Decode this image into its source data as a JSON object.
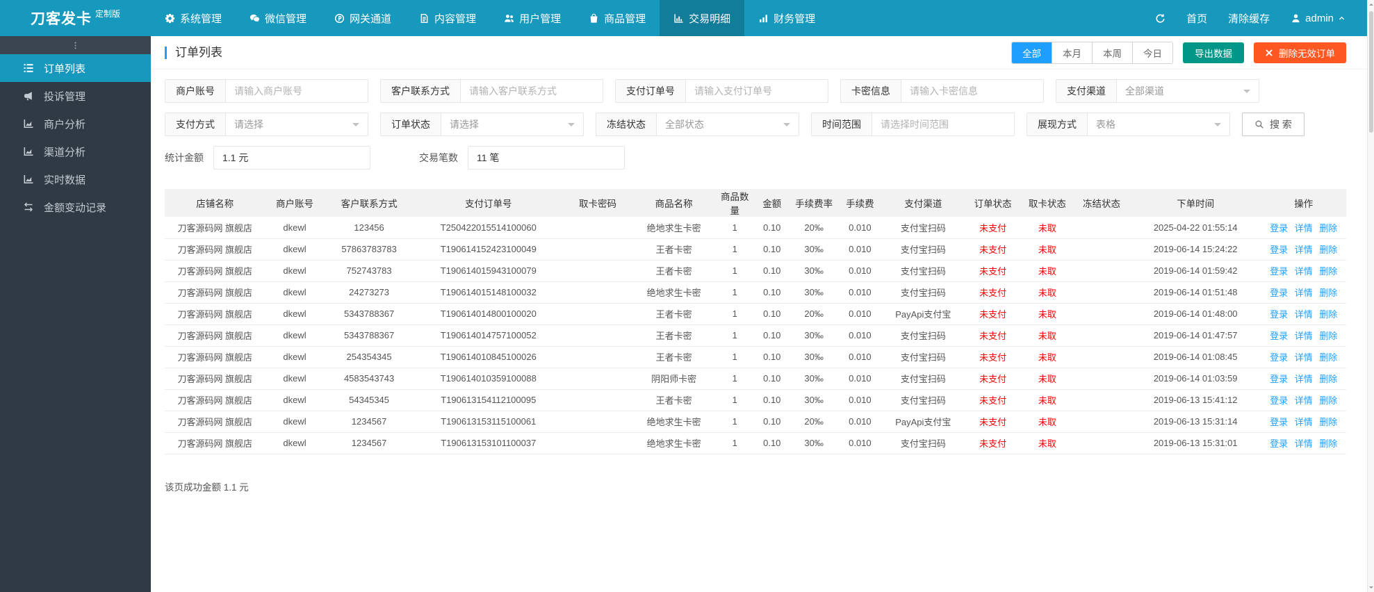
{
  "colors": {
    "navbar": "#1799BD",
    "sidebar": "#2F3A45",
    "accent_blue": "#1E9FFF",
    "teal": "#009688",
    "orange": "#FF5722",
    "status_red": "#FF0000"
  },
  "brand": {
    "name": "刀客发卡",
    "badge": "定制版"
  },
  "navbar": {
    "items": [
      {
        "label": "系统管理",
        "icon": "gear-icon",
        "active": false
      },
      {
        "label": "微信管理",
        "icon": "wechat-icon",
        "active": false
      },
      {
        "label": "网关通道",
        "icon": "gateway-icon",
        "active": false
      },
      {
        "label": "内容管理",
        "icon": "content-icon",
        "active": false
      },
      {
        "label": "用户管理",
        "icon": "users-icon",
        "active": false
      },
      {
        "label": "商品管理",
        "icon": "goods-icon",
        "active": false
      },
      {
        "label": "交易明细",
        "icon": "chart-bar-icon",
        "active": true
      },
      {
        "label": "财务管理",
        "icon": "finance-icon",
        "active": false
      }
    ],
    "refresh_icon": "refresh-icon",
    "home_label": "首页",
    "clear_cache_label": "清除缓存",
    "user_icon": "user-icon",
    "username": "admin",
    "caret_icon": "caret-up-icon"
  },
  "sidebar": {
    "toggle_icon": "ellipsis-v-icon",
    "items": [
      {
        "label": "订单列表",
        "icon": "list-icon",
        "active": true
      },
      {
        "label": "投诉管理",
        "icon": "bullhorn-icon",
        "active": false
      },
      {
        "label": "商户分析",
        "icon": "area-chart-icon",
        "active": false
      },
      {
        "label": "渠道分析",
        "icon": "area-chart-icon",
        "active": false
      },
      {
        "label": "实时数据",
        "icon": "area-chart-icon",
        "active": false
      },
      {
        "label": "金额变动记录",
        "icon": "exchange-icon",
        "active": false
      }
    ]
  },
  "page": {
    "title": "订单列表",
    "range_buttons": [
      {
        "label": "全部",
        "active": true
      },
      {
        "label": "本月",
        "active": false
      },
      {
        "label": "本周",
        "active": false
      },
      {
        "label": "今日",
        "active": false
      }
    ],
    "export_label": "导出数据",
    "delete_label": "删除无效订单",
    "delete_icon": "x-icon"
  },
  "filters": {
    "row1": [
      {
        "label": "商户账号",
        "placeholder": "请输入商户账号",
        "select": false
      },
      {
        "label": "客户联系方式",
        "placeholder": "请输入客户联系方式",
        "select": false
      },
      {
        "label": "支付订单号",
        "placeholder": "请输入支付订单号",
        "select": false
      },
      {
        "label": "卡密信息",
        "placeholder": "请输入卡密信息",
        "select": false
      },
      {
        "label": "支付渠道",
        "value": "全部渠道",
        "select": true
      }
    ],
    "row2": [
      {
        "label": "支付方式",
        "value": "请选择",
        "select": true
      },
      {
        "label": "订单状态",
        "value": "请选择",
        "select": true
      },
      {
        "label": "冻结状态",
        "value": "全部状态",
        "select": true
      },
      {
        "label": "时间范围",
        "placeholder": "请选择时间范围",
        "select": false
      },
      {
        "label": "展现方式",
        "value": "表格",
        "select": true
      }
    ],
    "search": {
      "label": "搜 索",
      "icon": "search-icon"
    },
    "stats": [
      {
        "label": "统计金额",
        "value": "1.1 元"
      },
      {
        "label": "交易笔数",
        "value": "11 笔"
      }
    ]
  },
  "table": {
    "columns": [
      "店铺名称",
      "商户账号",
      "客户联系方式",
      "支付订单号",
      "取卡密码",
      "商品名称",
      "商品数量",
      "金额",
      "手续费率",
      "手续费",
      "支付渠道",
      "订单状态",
      "取卡状态",
      "冻结状态",
      "下单时间",
      "操作"
    ],
    "action_labels": [
      "登录",
      "详情",
      "删除"
    ],
    "rows": [
      {
        "shop": "刀客源码网 旗舰店",
        "merchant": "dkewl",
        "contact": "123456",
        "trade_no": "T250422015514100060",
        "card_pwd": "",
        "product": "绝地求生卡密",
        "qty": "1",
        "amount": "0.10",
        "fee_rate": "20‰",
        "fee": "0.010",
        "channel": "支付宝扫码",
        "order_status": "未支付",
        "card_status": "未取",
        "freeze_status": "",
        "created_at": "2025-04-22 01:55:14"
      },
      {
        "shop": "刀客源码网 旗舰店",
        "merchant": "dkewl",
        "contact": "57863783783",
        "trade_no": "T190614152423100049",
        "card_pwd": "",
        "product": "王者卡密",
        "qty": "1",
        "amount": "0.10",
        "fee_rate": "30‰",
        "fee": "0.010",
        "channel": "支付宝扫码",
        "order_status": "未支付",
        "card_status": "未取",
        "freeze_status": "",
        "created_at": "2019-06-14 15:24:22"
      },
      {
        "shop": "刀客源码网 旗舰店",
        "merchant": "dkewl",
        "contact": "752743783",
        "trade_no": "T190614015943100079",
        "card_pwd": "",
        "product": "王者卡密",
        "qty": "1",
        "amount": "0.10",
        "fee_rate": "30‰",
        "fee": "0.010",
        "channel": "支付宝扫码",
        "order_status": "未支付",
        "card_status": "未取",
        "freeze_status": "",
        "created_at": "2019-06-14 01:59:42"
      },
      {
        "shop": "刀客源码网 旗舰店",
        "merchant": "dkewl",
        "contact": "24273273",
        "trade_no": "T190614015148100032",
        "card_pwd": "",
        "product": "绝地求生卡密",
        "qty": "1",
        "amount": "0.10",
        "fee_rate": "30‰",
        "fee": "0.010",
        "channel": "支付宝扫码",
        "order_status": "未支付",
        "card_status": "未取",
        "freeze_status": "",
        "created_at": "2019-06-14 01:51:48"
      },
      {
        "shop": "刀客源码网 旗舰店",
        "merchant": "dkewl",
        "contact": "5343788367",
        "trade_no": "T190614014800100020",
        "card_pwd": "",
        "product": "王者卡密",
        "qty": "1",
        "amount": "0.10",
        "fee_rate": "20‰",
        "fee": "0.010",
        "channel": "PayApi支付宝",
        "order_status": "未支付",
        "card_status": "未取",
        "freeze_status": "",
        "created_at": "2019-06-14 01:48:00"
      },
      {
        "shop": "刀客源码网 旗舰店",
        "merchant": "dkewl",
        "contact": "5343788367",
        "trade_no": "T190614014757100052",
        "card_pwd": "",
        "product": "王者卡密",
        "qty": "1",
        "amount": "0.10",
        "fee_rate": "30‰",
        "fee": "0.010",
        "channel": "支付宝扫码",
        "order_status": "未支付",
        "card_status": "未取",
        "freeze_status": "",
        "created_at": "2019-06-14 01:47:57"
      },
      {
        "shop": "刀客源码网 旗舰店",
        "merchant": "dkewl",
        "contact": "254354345",
        "trade_no": "T190614010845100026",
        "card_pwd": "",
        "product": "王者卡密",
        "qty": "1",
        "amount": "0.10",
        "fee_rate": "30‰",
        "fee": "0.010",
        "channel": "支付宝扫码",
        "order_status": "未支付",
        "card_status": "未取",
        "freeze_status": "",
        "created_at": "2019-06-14 01:08:45"
      },
      {
        "shop": "刀客源码网 旗舰店",
        "merchant": "dkewl",
        "contact": "4583543743",
        "trade_no": "T190614010359100088",
        "card_pwd": "",
        "product": "阴阳师卡密",
        "qty": "1",
        "amount": "0.10",
        "fee_rate": "30‰",
        "fee": "0.010",
        "channel": "支付宝扫码",
        "order_status": "未支付",
        "card_status": "未取",
        "freeze_status": "",
        "created_at": "2019-06-14 01:03:59"
      },
      {
        "shop": "刀客源码网 旗舰店",
        "merchant": "dkewl",
        "contact": "54345345",
        "trade_no": "T190613154112100095",
        "card_pwd": "",
        "product": "王者卡密",
        "qty": "1",
        "amount": "0.10",
        "fee_rate": "30‰",
        "fee": "0.010",
        "channel": "支付宝扫码",
        "order_status": "未支付",
        "card_status": "未取",
        "freeze_status": "",
        "created_at": "2019-06-13 15:41:12"
      },
      {
        "shop": "刀客源码网 旗舰店",
        "merchant": "dkewl",
        "contact": "1234567",
        "trade_no": "T190613153115100061",
        "card_pwd": "",
        "product": "绝地求生卡密",
        "qty": "1",
        "amount": "0.10",
        "fee_rate": "20‰",
        "fee": "0.010",
        "channel": "PayApi支付宝",
        "order_status": "未支付",
        "card_status": "未取",
        "freeze_status": "",
        "created_at": "2019-06-13 15:31:14"
      },
      {
        "shop": "刀客源码网 旗舰店",
        "merchant": "dkewl",
        "contact": "1234567",
        "trade_no": "T190613153101100037",
        "card_pwd": "",
        "product": "绝地求生卡密",
        "qty": "1",
        "amount": "0.10",
        "fee_rate": "30‰",
        "fee": "0.010",
        "channel": "支付宝扫码",
        "order_status": "未支付",
        "card_status": "未取",
        "freeze_status": "",
        "created_at": "2019-06-13 15:31:01"
      }
    ]
  },
  "footer": {
    "note": "该页成功金额 1.1 元"
  }
}
